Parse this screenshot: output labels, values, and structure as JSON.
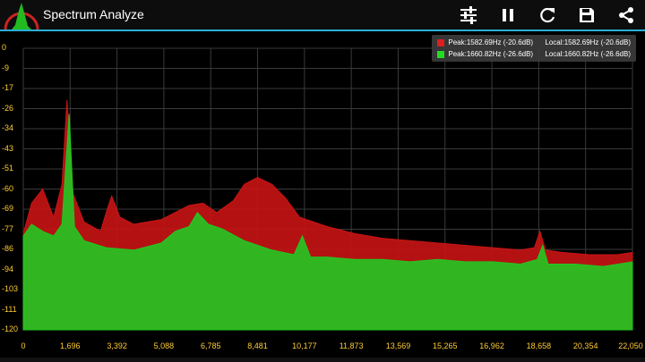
{
  "app": {
    "title": "Spectrum Analyze"
  },
  "toolbar": {
    "actions": [
      {
        "name": "settings-sliders-icon"
      },
      {
        "name": "pause-icon"
      },
      {
        "name": "refresh-icon"
      },
      {
        "name": "save-icon"
      },
      {
        "name": "share-icon"
      }
    ]
  },
  "legend": [
    {
      "color": "#dd1f1f",
      "peak": "Peak:1582.69Hz (-20.6dB)",
      "local": "Local:1582.69Hz (-20.6dB)"
    },
    {
      "color": "#22dd22",
      "peak": "Peak:1660.82Hz (-26.6dB)",
      "local": "Local:1660.82Hz (-26.6dB)"
    }
  ],
  "chart_data": {
    "type": "area",
    "xlim": [
      0,
      22050
    ],
    "ylim": [
      -120,
      0
    ],
    "x_ticks": [
      "0",
      "1,696",
      "3,392",
      "5,088",
      "6,785",
      "8,481",
      "10,177",
      "11,873",
      "13,569",
      "15,265",
      "16,962",
      "18,658",
      "20,354",
      "22,050"
    ],
    "y_ticks": [
      "0",
      "-9",
      "-17",
      "-26",
      "-34",
      "-43",
      "-51",
      "-60",
      "-69",
      "-77",
      "-86",
      "-94",
      "-103",
      "-111",
      "-120"
    ],
    "grid": true,
    "series": [
      {
        "color": "#c81414",
        "points": [
          [
            0,
            -79
          ],
          [
            300,
            -66
          ],
          [
            700,
            -60
          ],
          [
            1100,
            -72
          ],
          [
            1400,
            -58
          ],
          [
            1582,
            -22
          ],
          [
            1800,
            -62
          ],
          [
            2200,
            -74
          ],
          [
            2800,
            -78
          ],
          [
            3000,
            -70
          ],
          [
            3200,
            -63
          ],
          [
            3500,
            -72
          ],
          [
            4000,
            -75
          ],
          [
            5000,
            -73
          ],
          [
            6000,
            -67
          ],
          [
            6500,
            -66
          ],
          [
            7000,
            -70
          ],
          [
            7600,
            -65
          ],
          [
            8000,
            -58
          ],
          [
            8481,
            -55
          ],
          [
            9000,
            -58
          ],
          [
            9500,
            -64
          ],
          [
            10000,
            -72
          ],
          [
            11000,
            -76
          ],
          [
            12000,
            -79
          ],
          [
            13000,
            -81
          ],
          [
            14000,
            -82
          ],
          [
            15000,
            -83
          ],
          [
            16000,
            -84
          ],
          [
            17000,
            -85
          ],
          [
            18000,
            -86
          ],
          [
            18500,
            -85
          ],
          [
            18700,
            -78
          ],
          [
            18900,
            -86
          ],
          [
            19500,
            -87
          ],
          [
            20500,
            -88
          ],
          [
            21500,
            -88
          ],
          [
            22050,
            -87
          ]
        ]
      },
      {
        "color": "#22c822",
        "points": [
          [
            0,
            -80
          ],
          [
            300,
            -75
          ],
          [
            700,
            -78
          ],
          [
            1100,
            -80
          ],
          [
            1400,
            -75
          ],
          [
            1660,
            -28
          ],
          [
            1850,
            -76
          ],
          [
            2200,
            -82
          ],
          [
            3000,
            -85
          ],
          [
            4000,
            -86
          ],
          [
            5000,
            -83
          ],
          [
            5500,
            -78
          ],
          [
            6000,
            -76
          ],
          [
            6300,
            -70
          ],
          [
            6700,
            -75
          ],
          [
            7200,
            -77
          ],
          [
            8000,
            -82
          ],
          [
            9000,
            -86
          ],
          [
            9800,
            -88
          ],
          [
            10100,
            -80
          ],
          [
            10400,
            -89
          ],
          [
            11000,
            -89
          ],
          [
            12000,
            -90
          ],
          [
            13000,
            -90
          ],
          [
            14000,
            -91
          ],
          [
            15000,
            -90
          ],
          [
            16000,
            -91
          ],
          [
            17000,
            -91
          ],
          [
            18000,
            -92
          ],
          [
            18600,
            -90
          ],
          [
            18800,
            -84
          ],
          [
            19000,
            -92
          ],
          [
            20000,
            -92
          ],
          [
            21000,
            -93
          ],
          [
            22050,
            -91
          ]
        ]
      }
    ]
  }
}
